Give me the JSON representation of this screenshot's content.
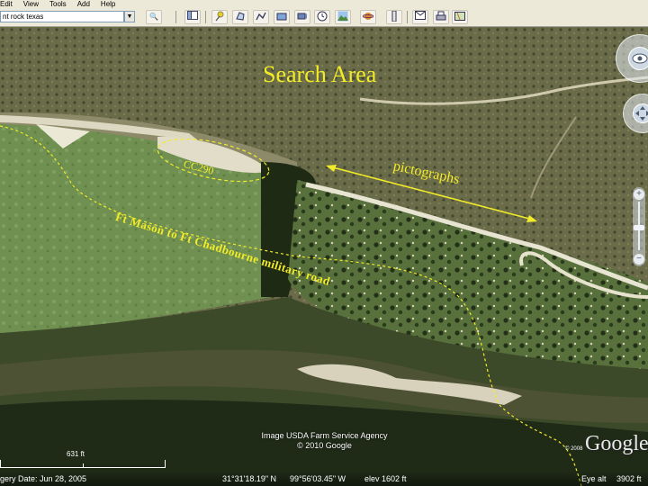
{
  "menu": {
    "items": [
      "Edit",
      "View",
      "Tools",
      "Add",
      "Help"
    ]
  },
  "toolbar": {
    "search_value": "nt rock texas",
    "dropdown_glyph": "▼",
    "search_glyph": "🔍"
  },
  "map_labels": {
    "search_area": "Search Area",
    "pictographs": "pictographs",
    "site_id": "CC290",
    "road": "Ft Mason to Ft Chadbourne military road"
  },
  "attribution": {
    "image_credit": "Image USDA Farm Service Agency",
    "copyright": "© 2010 Google",
    "logo": "Google",
    "logo_copyright": "© 2008"
  },
  "scale": {
    "label": "631 ft"
  },
  "status": {
    "imagery_date": "gery Date: Jun 28, 2005",
    "latitude": "31°31'18.19\" N",
    "longitude": "99°56'03.45\" W",
    "elevation": "elev  1602 ft",
    "eye_altitude_label": "Eye alt",
    "eye_altitude_value": "3902 ft"
  },
  "colors": {
    "annotation": "#f2ec28",
    "toolbar": "#ece9d8"
  }
}
